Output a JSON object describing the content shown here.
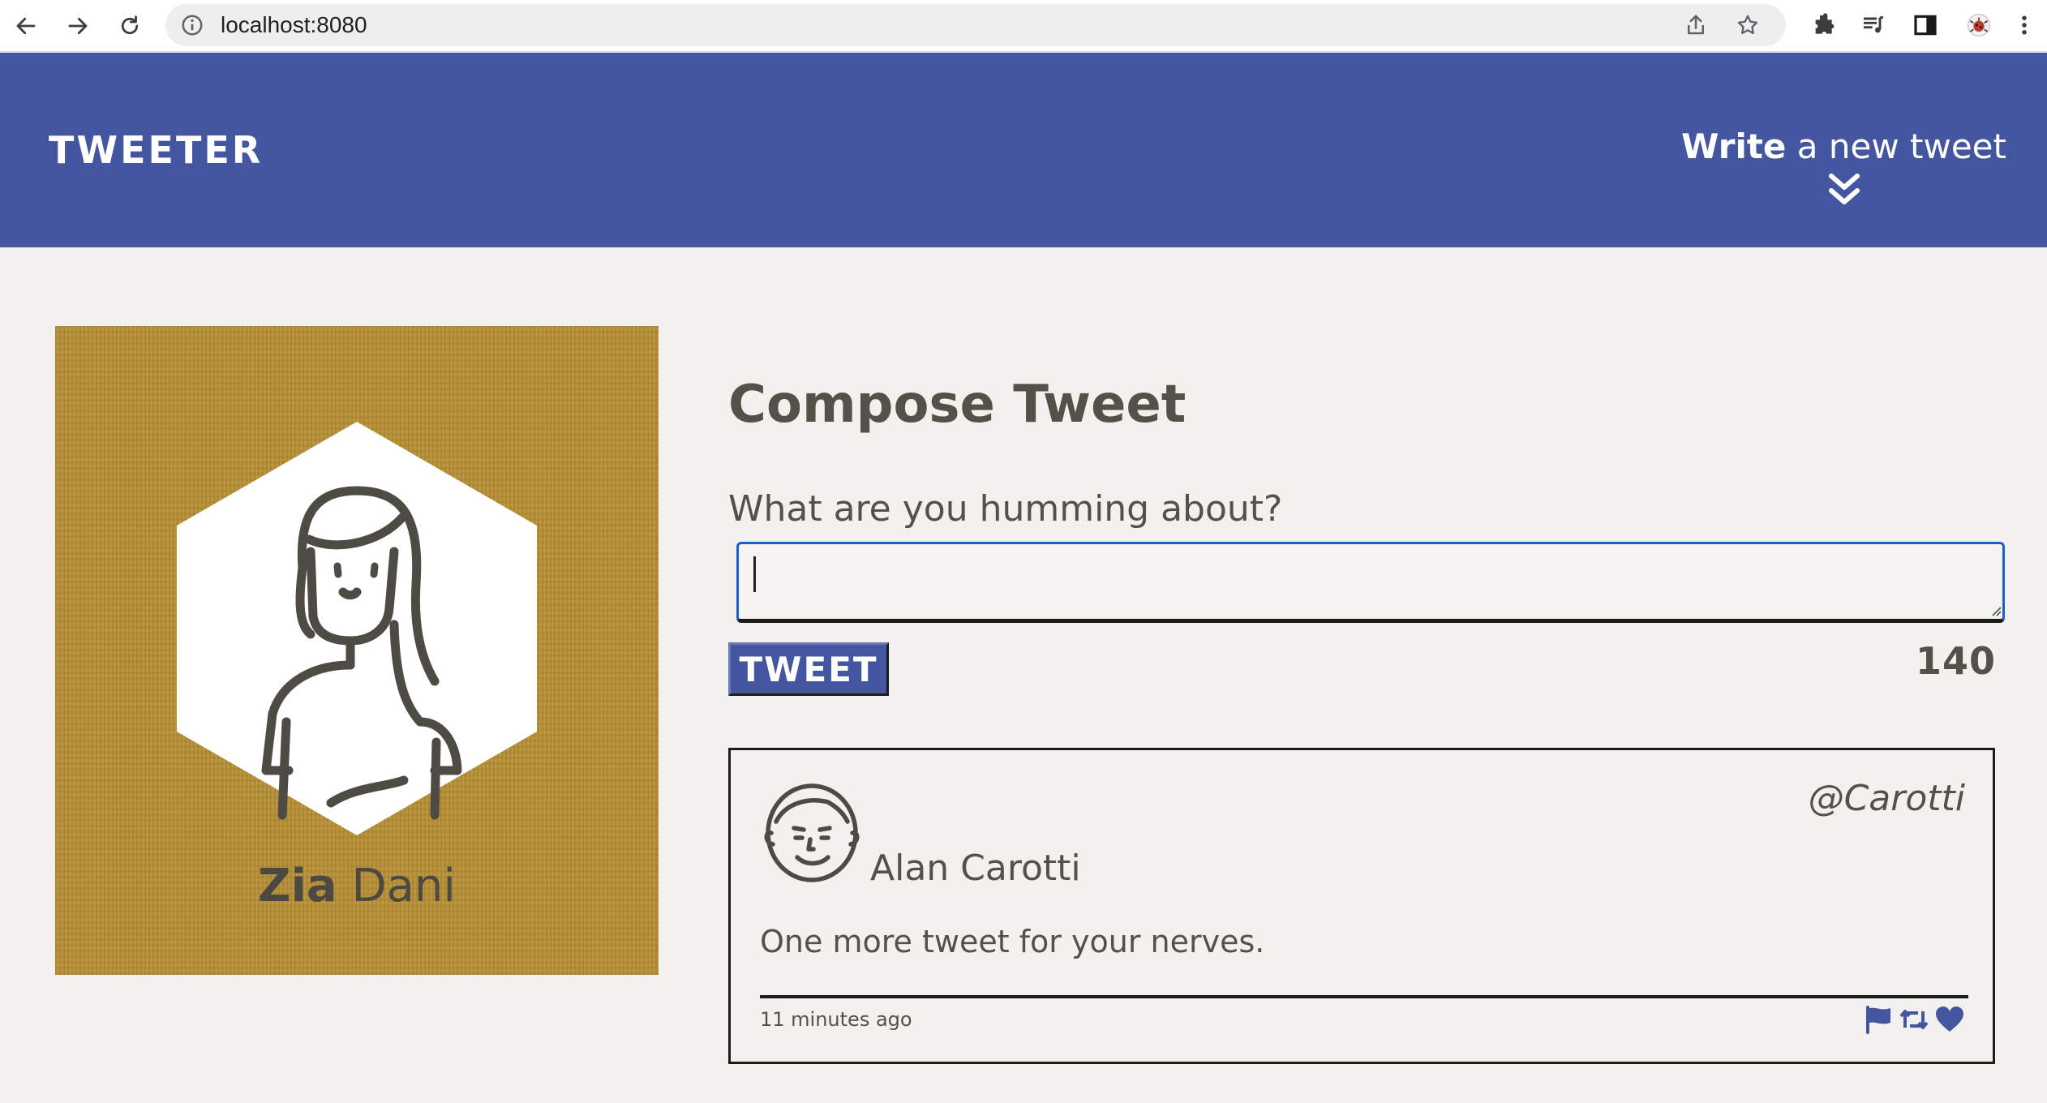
{
  "browser": {
    "url": "localhost:8080"
  },
  "header": {
    "logo": "Tweeter",
    "compose_toggle_bold": "Write",
    "compose_toggle_rest": " a new tweet"
  },
  "profile": {
    "first_name": "Zia",
    "last_name": "Dani",
    "card_color": "#b89236"
  },
  "compose": {
    "title": "Compose Tweet",
    "label": "What are you humming about?",
    "textarea_value": "",
    "button_label": "Tweet",
    "counter": "140"
  },
  "tweets": [
    {
      "author": "Alan Carotti",
      "handle": "@Carotti",
      "content": "One more tweet for your nerves.",
      "time_ago": "11 minutes ago"
    }
  ],
  "colors": {
    "brand": "#4456a0",
    "background": "#f2f1ee",
    "text": "#545149"
  }
}
